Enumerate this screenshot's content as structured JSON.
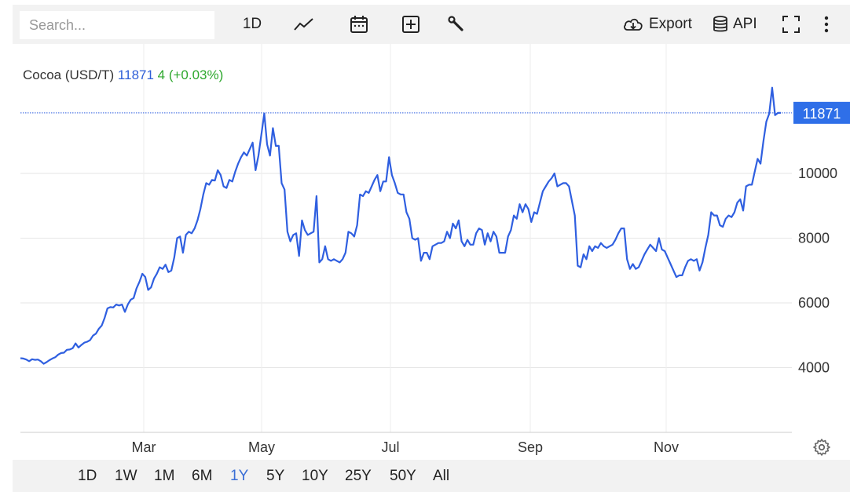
{
  "toolbar": {
    "search_placeholder": "Search...",
    "interval_label": "1D",
    "export_label": "Export",
    "api_label": "API",
    "icons": [
      "line-chart-icon",
      "calendar-icon",
      "plus-box-icon",
      "wrench-icon",
      "cloud-download-icon",
      "database-icon",
      "fullscreen-icon",
      "more-vertical-icon"
    ]
  },
  "legend": {
    "name": "Cocoa (USD/T)",
    "price": "11871",
    "change": "4 (+0.03%)",
    "price_color": "#2f5fd8",
    "change_color": "#2ea82e"
  },
  "last_price_tag": "11871",
  "ranges": {
    "items": [
      "1D",
      "1W",
      "1M",
      "6M",
      "1Y",
      "5Y",
      "10Y",
      "25Y",
      "50Y",
      "All"
    ],
    "active": "1Y"
  },
  "colors": {
    "line": "#2f5fe0",
    "tag_bg": "#2f6fe8",
    "active_range": "#3b6fd6"
  },
  "chart_data": {
    "type": "line",
    "title": "",
    "xlabel": "",
    "ylabel": "",
    "ylim": [
      2000,
      12500
    ],
    "yticks": [
      4000,
      6000,
      8000,
      10000
    ],
    "xtick_labels": [
      "Mar",
      "May",
      "Jul",
      "Sep",
      "Nov"
    ],
    "xtick_positions": [
      1.38,
      3.33,
      5.31,
      7.35,
      9.45
    ],
    "x_range": [
      0,
      11.6
    ],
    "series": [
      {
        "values": [
          [
            0.0,
            4290
          ],
          [
            0.05,
            4280
          ],
          [
            0.1,
            4250
          ],
          [
            0.15,
            4200
          ],
          [
            0.2,
            4260
          ],
          [
            0.25,
            4240
          ],
          [
            0.3,
            4250
          ],
          [
            0.35,
            4200
          ],
          [
            0.4,
            4120
          ],
          [
            0.45,
            4170
          ],
          [
            0.5,
            4230
          ],
          [
            0.55,
            4280
          ],
          [
            0.6,
            4320
          ],
          [
            0.65,
            4400
          ],
          [
            0.7,
            4450
          ],
          [
            0.75,
            4460
          ],
          [
            0.8,
            4550
          ],
          [
            0.85,
            4560
          ],
          [
            0.9,
            4600
          ],
          [
            0.95,
            4750
          ],
          [
            1.0,
            4620
          ],
          [
            1.05,
            4700
          ],
          [
            1.1,
            4770
          ],
          [
            1.15,
            4800
          ],
          [
            1.2,
            4850
          ],
          [
            1.25,
            4990
          ],
          [
            1.3,
            5050
          ],
          [
            1.35,
            5200
          ],
          [
            1.4,
            5300
          ],
          [
            1.45,
            5530
          ],
          [
            1.5,
            5830
          ],
          [
            1.55,
            5870
          ],
          [
            1.6,
            5860
          ],
          [
            1.65,
            5950
          ],
          [
            1.7,
            5920
          ],
          [
            1.75,
            5950
          ],
          [
            1.8,
            5720
          ],
          [
            1.85,
            5950
          ],
          [
            1.9,
            6100
          ],
          [
            1.95,
            6150
          ],
          [
            2.0,
            6450
          ],
          [
            2.05,
            6650
          ],
          [
            2.1,
            6900
          ],
          [
            2.15,
            6800
          ],
          [
            2.2,
            6400
          ],
          [
            2.25,
            6480
          ],
          [
            2.3,
            6750
          ],
          [
            2.35,
            6900
          ],
          [
            2.4,
            7100
          ],
          [
            2.45,
            7050
          ],
          [
            2.5,
            7180
          ],
          [
            2.55,
            6950
          ],
          [
            2.6,
            7000
          ],
          [
            2.65,
            7400
          ],
          [
            2.7,
            8000
          ],
          [
            2.75,
            8050
          ],
          [
            2.8,
            7550
          ],
          [
            2.85,
            8100
          ],
          [
            2.9,
            8200
          ],
          [
            2.95,
            8150
          ],
          [
            3.0,
            8300
          ],
          [
            3.05,
            8550
          ],
          [
            3.1,
            8900
          ],
          [
            3.15,
            9350
          ],
          [
            3.2,
            9700
          ],
          [
            3.25,
            9650
          ],
          [
            3.3,
            9800
          ],
          [
            3.35,
            9780
          ],
          [
            3.4,
            10100
          ],
          [
            3.45,
            9950
          ],
          [
            3.5,
            9600
          ],
          [
            3.55,
            9550
          ],
          [
            3.6,
            9800
          ],
          [
            3.65,
            9750
          ],
          [
            3.7,
            10050
          ],
          [
            3.75,
            10300
          ],
          [
            3.8,
            10500
          ],
          [
            3.85,
            10650
          ],
          [
            3.9,
            10550
          ],
          [
            3.95,
            10750
          ],
          [
            4.0,
            10950
          ],
          [
            4.05,
            10100
          ],
          [
            4.1,
            10550
          ],
          [
            4.15,
            11200
          ],
          [
            4.2,
            11850
          ],
          [
            4.25,
            10900
          ],
          [
            4.3,
            10550
          ],
          [
            4.35,
            11400
          ],
          [
            4.4,
            10850
          ],
          [
            4.45,
            10850
          ],
          [
            4.5,
            9700
          ],
          [
            4.55,
            9500
          ],
          [
            4.6,
            8200
          ],
          [
            4.65,
            7900
          ],
          [
            4.7,
            8100
          ],
          [
            4.75,
            8150
          ],
          [
            4.8,
            7450
          ],
          [
            4.85,
            8550
          ],
          [
            4.9,
            8250
          ],
          [
            4.95,
            8100
          ],
          [
            5.0,
            8150
          ],
          [
            5.05,
            8200
          ],
          [
            5.1,
            9300
          ],
          [
            5.15,
            7250
          ],
          [
            5.2,
            7350
          ],
          [
            5.25,
            7750
          ],
          [
            5.3,
            7350
          ],
          [
            5.35,
            7300
          ],
          [
            5.4,
            7350
          ],
          [
            5.45,
            7300
          ],
          [
            5.5,
            7250
          ],
          [
            5.55,
            7350
          ],
          [
            5.6,
            7550
          ],
          [
            5.65,
            8200
          ],
          [
            5.7,
            8150
          ],
          [
            5.75,
            8050
          ],
          [
            5.8,
            8400
          ],
          [
            5.85,
            9350
          ],
          [
            5.9,
            9300
          ],
          [
            5.95,
            9450
          ],
          [
            6.0,
            9400
          ],
          [
            6.05,
            9600
          ],
          [
            6.1,
            9800
          ],
          [
            6.15,
            9950
          ],
          [
            6.2,
            9450
          ],
          [
            6.25,
            9750
          ],
          [
            6.3,
            9750
          ],
          [
            6.35,
            10500
          ],
          [
            6.4,
            9950
          ],
          [
            6.45,
            9700
          ],
          [
            6.5,
            9400
          ],
          [
            6.55,
            9350
          ],
          [
            6.6,
            9350
          ],
          [
            6.65,
            8800
          ],
          [
            6.7,
            8600
          ],
          [
            6.75,
            8000
          ],
          [
            6.8,
            7950
          ],
          [
            6.85,
            8000
          ],
          [
            6.9,
            7300
          ],
          [
            6.95,
            7550
          ],
          [
            7.0,
            7550
          ],
          [
            7.05,
            7350
          ],
          [
            7.1,
            7750
          ],
          [
            7.15,
            7800
          ],
          [
            7.2,
            7850
          ],
          [
            7.25,
            7850
          ],
          [
            7.3,
            7900
          ],
          [
            7.35,
            8200
          ],
          [
            7.4,
            8000
          ],
          [
            7.45,
            8450
          ],
          [
            7.5,
            8300
          ],
          [
            7.55,
            8550
          ],
          [
            7.6,
            7900
          ],
          [
            7.65,
            7750
          ],
          [
            7.7,
            7950
          ],
          [
            7.75,
            7800
          ],
          [
            7.8,
            7800
          ],
          [
            7.85,
            8150
          ],
          [
            7.9,
            8300
          ],
          [
            7.95,
            8250
          ],
          [
            8.0,
            7800
          ],
          [
            8.05,
            8150
          ],
          [
            8.1,
            7900
          ],
          [
            8.15,
            8200
          ],
          [
            8.2,
            8050
          ],
          [
            8.25,
            7550
          ],
          [
            8.3,
            7550
          ],
          [
            8.35,
            7550
          ],
          [
            8.4,
            8050
          ],
          [
            8.45,
            8250
          ],
          [
            8.5,
            8700
          ],
          [
            8.55,
            8600
          ],
          [
            8.6,
            9050
          ],
          [
            8.65,
            8800
          ],
          [
            8.7,
            9050
          ],
          [
            8.75,
            8900
          ],
          [
            8.8,
            8500
          ],
          [
            8.85,
            8800
          ],
          [
            8.9,
            8750
          ],
          [
            8.95,
            9100
          ],
          [
            9.0,
            9450
          ],
          [
            9.05,
            9600
          ],
          [
            9.1,
            9750
          ],
          [
            9.15,
            9850
          ],
          [
            9.2,
            10000
          ],
          [
            9.25,
            9600
          ],
          [
            9.3,
            9650
          ],
          [
            9.35,
            9700
          ],
          [
            9.4,
            9700
          ],
          [
            9.45,
            9600
          ],
          [
            9.5,
            9150
          ],
          [
            9.55,
            8700
          ],
          [
            9.6,
            7150
          ],
          [
            9.65,
            7100
          ],
          [
            9.7,
            7500
          ],
          [
            9.75,
            7350
          ],
          [
            9.8,
            7750
          ],
          [
            9.85,
            7600
          ],
          [
            9.9,
            7750
          ],
          [
            9.95,
            7700
          ],
          [
            10.0,
            7850
          ],
          [
            10.05,
            7750
          ],
          [
            10.1,
            7700
          ],
          [
            10.15,
            7750
          ],
          [
            10.2,
            7800
          ],
          [
            10.25,
            7950
          ],
          [
            10.3,
            8150
          ],
          [
            10.35,
            8300
          ],
          [
            10.4,
            8300
          ],
          [
            10.45,
            7350
          ],
          [
            10.5,
            7050
          ],
          [
            10.55,
            7200
          ],
          [
            10.6,
            7050
          ],
          [
            10.65,
            7100
          ],
          [
            10.7,
            7300
          ],
          [
            10.75,
            7500
          ],
          [
            10.8,
            7650
          ],
          [
            10.85,
            7800
          ],
          [
            10.9,
            7700
          ],
          [
            10.95,
            7600
          ],
          [
            11.0,
            8000
          ],
          [
            11.05,
            7650
          ],
          [
            11.1,
            7600
          ],
          [
            11.15,
            7400
          ],
          [
            11.2,
            7200
          ],
          [
            11.25,
            7000
          ],
          [
            11.3,
            6800
          ],
          [
            11.35,
            6850
          ],
          [
            11.4,
            6850
          ],
          [
            11.45,
            7100
          ],
          [
            11.5,
            7300
          ],
          [
            11.55,
            7350
          ],
          [
            11.6,
            7300
          ]
        ],
        "tail": [
          [
            11.6,
            7300
          ],
          [
            11.65,
            7350
          ],
          [
            11.7,
            7000
          ],
          [
            11.75,
            7250
          ],
          [
            11.8,
            7700
          ],
          [
            11.85,
            8100
          ],
          [
            11.9,
            8800
          ],
          [
            11.95,
            8700
          ],
          [
            12.0,
            8700
          ],
          [
            12.05,
            8400
          ],
          [
            12.1,
            8350
          ],
          [
            12.15,
            8600
          ],
          [
            12.2,
            8700
          ],
          [
            12.25,
            8650
          ],
          [
            12.3,
            8800
          ],
          [
            12.35,
            9100
          ],
          [
            12.4,
            9200
          ],
          [
            12.45,
            8850
          ],
          [
            12.5,
            9600
          ],
          [
            12.55,
            9650
          ],
          [
            12.6,
            9650
          ],
          [
            12.65,
            10050
          ],
          [
            12.7,
            10450
          ],
          [
            12.75,
            10300
          ],
          [
            12.8,
            11000
          ],
          [
            12.85,
            11600
          ],
          [
            12.9,
            11850
          ],
          [
            12.95,
            12650
          ],
          [
            13.0,
            11800
          ],
          [
            13.05,
            11870
          ],
          [
            13.1,
            11871
          ]
        ]
      }
    ]
  }
}
